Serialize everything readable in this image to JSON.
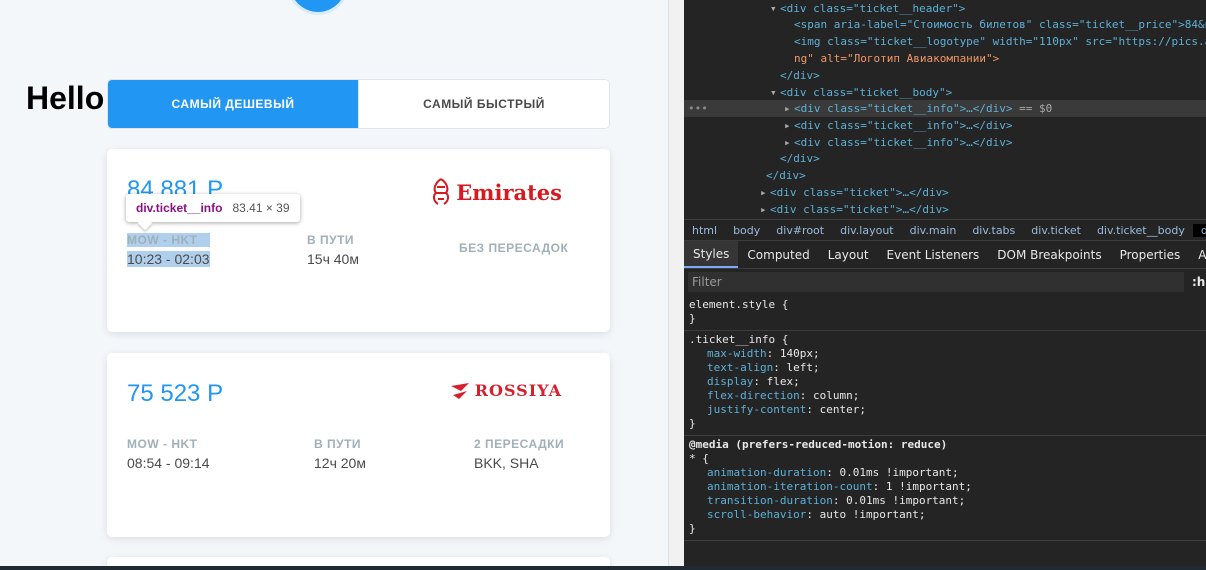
{
  "app": {
    "hello": "Hello",
    "tabs": {
      "cheapest": "САМЫЙ ДЕШЕВЫЙ",
      "fastest": "САМЫЙ БЫСТРЫЙ"
    },
    "tickets": [
      {
        "price": "84 881 Р",
        "airline": "Emirates",
        "route_label": "MOW - HKT",
        "route_time": "10:23 - 02:03",
        "duration_label": "В ПУТИ",
        "duration": "15ч 40м",
        "stops_label": "БЕЗ ПЕРЕСАДОК",
        "stops": ""
      },
      {
        "price": "75 523 Р",
        "airline": "ROSSIYA",
        "route_label": "MOW - HKT",
        "route_time": "08:54 - 09:14",
        "duration_label": "В ПУТИ",
        "duration": "12ч 20м",
        "stops_label": "2 ПЕРЕСАДКИ",
        "stops": "BKK, SHA"
      }
    ],
    "tooltip": {
      "name": "div.ticket__info",
      "size": "83.41 × 39"
    },
    "colors": {
      "accent": "#2196f3",
      "emirates": "#d71921",
      "rossiya": "#d6202c"
    }
  },
  "devtools": {
    "dom": [
      {
        "text_tag": "<div class=\"ticket__header\">"
      },
      {
        "span": "<span aria-label=\"Стоимость билетов\" class=\"ticket__price\">84&n"
      },
      {
        "img": "<img class=\"ticket__logotype\" width=\"110px\" src=\"https://pics.a",
        "img_tail": "ng\" alt=\"Логотип Авиакомпании\">"
      },
      {
        "close": "</div>"
      },
      {
        "open_body": "<div class=\"ticket__body\">"
      },
      {
        "info1": "<div class=\"ticket__info\">…</div>",
        "eq": " == $0"
      },
      {
        "info2": "<div class=\"ticket__info\">…</div>"
      },
      {
        "info3": "<div class=\"ticket__info\">…</div>"
      },
      {
        "close": "</div>"
      },
      {
        "close": "</div>"
      },
      {
        "ticket": "<div class=\"ticket\">…</div>"
      },
      {
        "ticket": "<div class=\"ticket\">…</div>"
      }
    ],
    "breadcrumbs": [
      "html",
      "body",
      "div#root",
      "div.layout",
      "div.main",
      "div.tabs",
      "div.ticket",
      "div.ticket__body",
      "div.ticke"
    ],
    "panel_tabs": [
      "Styles",
      "Computed",
      "Layout",
      "Event Listeners",
      "DOM Breakpoints",
      "Properties",
      "Accessib"
    ],
    "filter": {
      "placeholder": "Filter",
      "hov": ":h"
    },
    "rules": {
      "element_style": {
        "selector": "element.style {",
        "close": "}"
      },
      "ticket_info": {
        "selector": ".ticket__info {",
        "props": [
          {
            "name": "max-width",
            "value": "140px;"
          },
          {
            "name": "text-align",
            "value": "left;"
          },
          {
            "name": "display",
            "value": "flex;"
          },
          {
            "name": "flex-direction",
            "value": "column;"
          },
          {
            "name": "justify-content",
            "value": "center;"
          }
        ],
        "close": "}"
      },
      "media": {
        "at": "@media (prefers-reduced-motion: reduce)",
        "selector": "* {",
        "props": [
          {
            "name": "animation-duration",
            "value": "0.01ms !important;"
          },
          {
            "name": "animation-iteration-count",
            "value": "1 !important;"
          },
          {
            "name": "transition-duration",
            "value": "0.01ms !important;"
          },
          {
            "name": "scroll-behavior",
            "value": "auto !important;"
          }
        ],
        "close": "}"
      }
    }
  }
}
